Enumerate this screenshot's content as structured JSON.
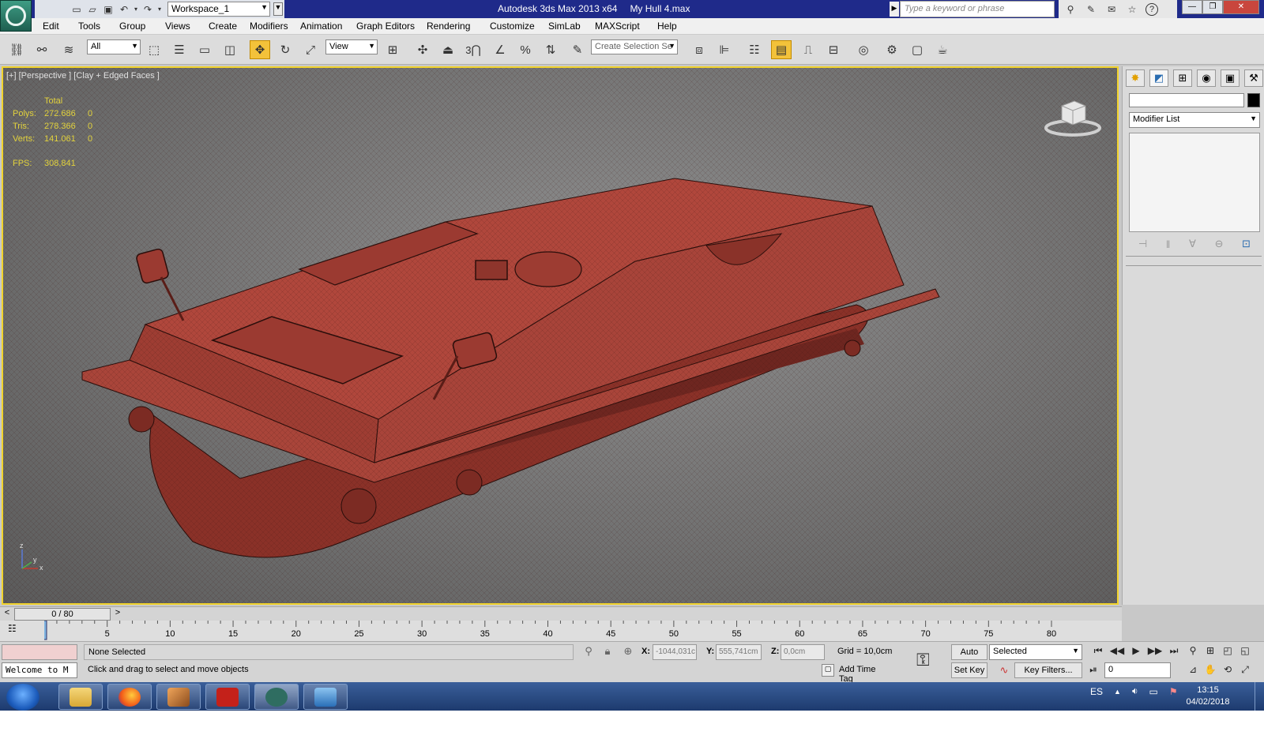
{
  "titlebar": {
    "workspace": "Workspace_1",
    "app_title": "Autodesk 3ds Max  2013 x64",
    "file_name": "My Hull 4.max",
    "search_placeholder": "Type a keyword or phrase"
  },
  "menu": [
    "Edit",
    "Tools",
    "Group",
    "Views",
    "Create",
    "Modifiers",
    "Animation",
    "Graph Editors",
    "Rendering",
    "Customize",
    "SimLab",
    "MAXScript",
    "Help"
  ],
  "toolbar": {
    "selection_filter": "All",
    "ref_coord": "View",
    "snap_label": "3",
    "named_selection_placeholder": "Create Selection Se"
  },
  "viewport": {
    "label": "[+] [Perspective ] [Clay + Edged Faces ]",
    "stats_header": "Total",
    "stats": [
      {
        "label": "Polys:",
        "total": "272.686",
        "sel": "0"
      },
      {
        "label": "Tris:",
        "total": "278.366",
        "sel": "0"
      },
      {
        "label": "Verts:",
        "total": "141.061",
        "sel": "0"
      }
    ],
    "fps_label": "FPS:",
    "fps_value": "308,841",
    "axis_z": "z",
    "axis_x": "x",
    "axis_y": "y",
    "model_color": "#b0473c"
  },
  "command_panel": {
    "modifier_list": "Modifier List"
  },
  "timeline": {
    "slider": "0 / 80",
    "ticks": [
      "5",
      "10",
      "15",
      "20",
      "25",
      "30",
      "35",
      "40",
      "45",
      "50",
      "55",
      "60",
      "65",
      "70",
      "75",
      "80"
    ]
  },
  "status": {
    "listener": "Welcome to M",
    "selection": "None Selected",
    "prompt": "Click and drag to select and move objects",
    "x_label": "X:",
    "x_value": "-1044,031c",
    "y_label": "Y:",
    "y_value": "555,741cm",
    "z_label": "Z:",
    "z_value": "0,0cm",
    "grid": "Grid = 10,0cm",
    "add_time_tag": "Add Time Tag",
    "auto_key": "Auto Key",
    "set_key": "Set Key",
    "key_mode": "Selected",
    "key_filters": "Key Filters...",
    "frame": "0"
  },
  "taskbar": {
    "lang": "ES",
    "time": "13:15",
    "date": "04/02/2018"
  }
}
